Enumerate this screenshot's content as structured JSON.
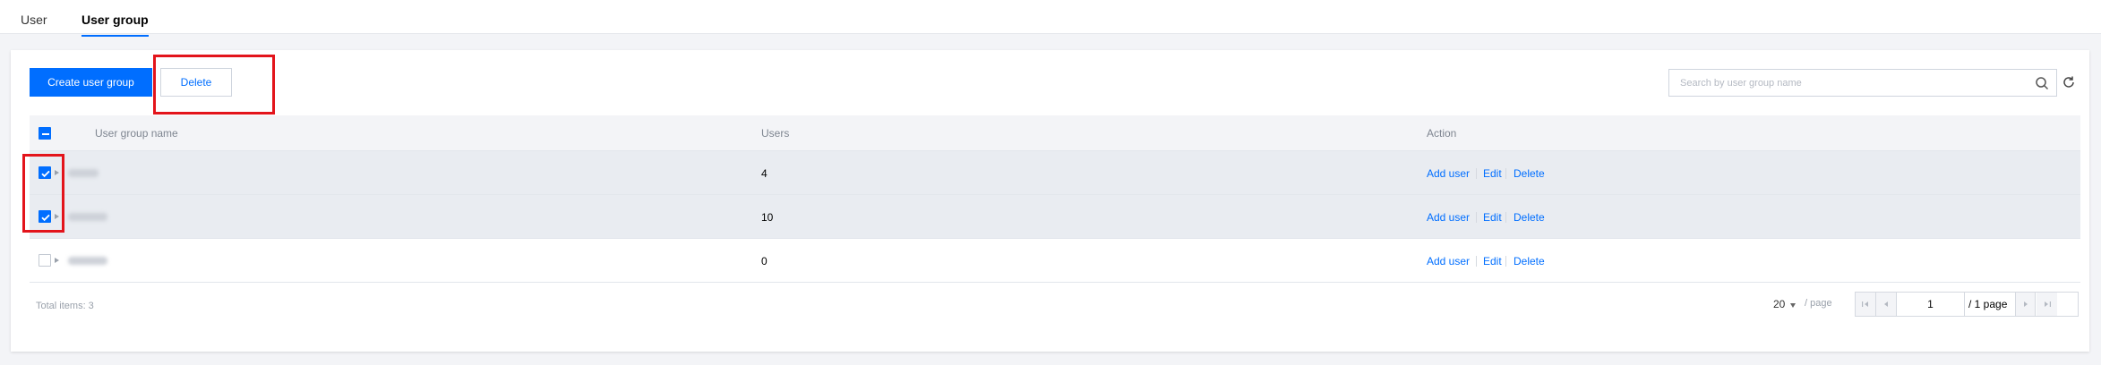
{
  "tabs": [
    {
      "label": "User",
      "active": false
    },
    {
      "label": "User group",
      "active": true
    }
  ],
  "toolbar": {
    "create_label": "Create user group",
    "delete_label": "Delete"
  },
  "search": {
    "placeholder": "Search by user group name",
    "icon": "search-icon",
    "refresh_icon": "refresh-icon"
  },
  "table": {
    "columns": [
      "User group name",
      "Users",
      "Action"
    ],
    "rows": [
      {
        "name": "",
        "users": "4",
        "checked": true,
        "actions": [
          "Add user",
          "Edit",
          "Delete"
        ]
      },
      {
        "name": "",
        "users": "10",
        "checked": true,
        "actions": [
          "Add user",
          "Edit",
          "Delete"
        ]
      },
      {
        "name": "",
        "users": "0",
        "checked": false,
        "actions": [
          "Add user",
          "Edit",
          "Delete"
        ]
      }
    ]
  },
  "footer": {
    "total": "Total items: 3",
    "page_size": "20",
    "per_page": "/ page",
    "current_page": "1",
    "page_total": "/ 1 page"
  },
  "colors": {
    "primary": "#006eff",
    "annotation": "#e3141b",
    "selected_row": "#e9ecf1"
  }
}
